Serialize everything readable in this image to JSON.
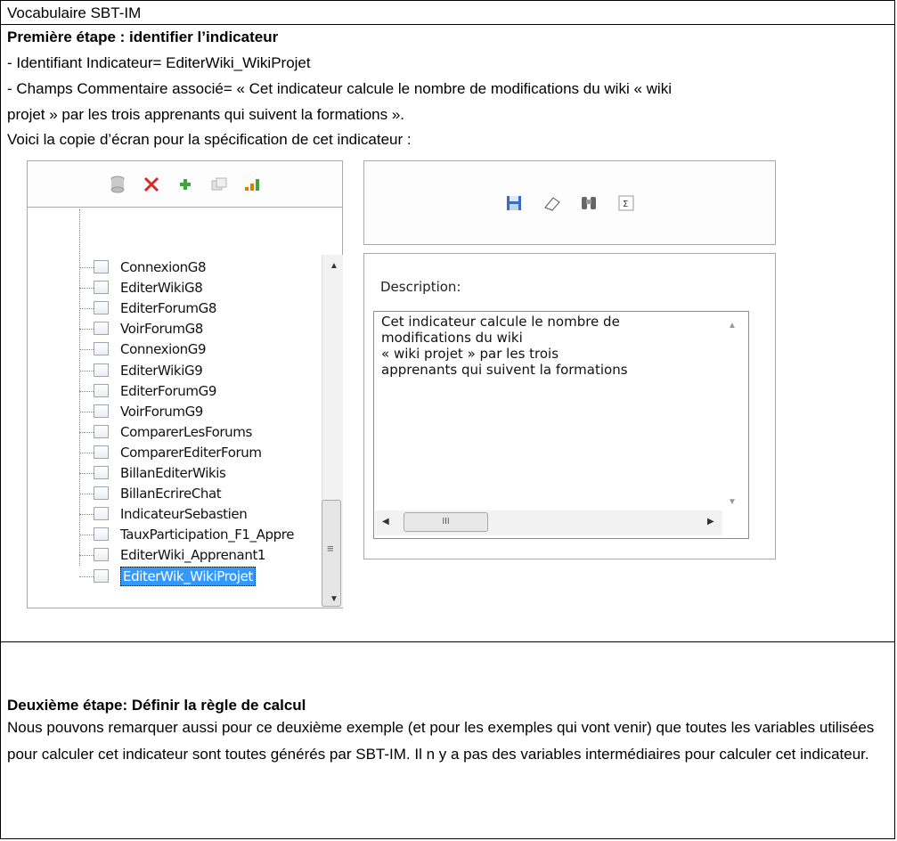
{
  "header": {
    "title": "Vocabulaire SBT-IM"
  },
  "step1": {
    "heading": "Première étape : identifier l’indicateur",
    "line1": "- Identifiant Indicateur= EditerWiki_WikiProjet",
    "line2": "- Champs Commentaire associé= « Cet indicateur calcule le nombre de modifications du wiki « wiki",
    "line3": "projet » par les trois apprenants qui suivent la formations ».",
    "line4": "Voici la copie d’écran pour la spécification de cet indicateur :"
  },
  "screenshot": {
    "left_toolbar_icons": [
      "database-icon",
      "delete-icon",
      "add-icon",
      "copy-icon",
      "chart-icon"
    ],
    "right_toolbar_icons": [
      "save-icon",
      "eraser-icon",
      "binoculars-icon",
      "formula-icon"
    ],
    "tree_items": [
      "ConnexionG8",
      "EditerWikiG8",
      "EditerForumG8",
      "VoirForumG8",
      "ConnexionG9",
      "EditerWikiG9",
      "EditerForumG9",
      "VoirForumG9",
      "ComparerLesForums",
      "ComparerEditerForum",
      "BillanEditerWikis",
      "BillanEcrireChat",
      "IndicateurSebastien",
      "TauxParticipation_F1_Appre",
      "EditerWiki_Apprenant1",
      "EditerWik_WikiProjet"
    ],
    "selected_item": "EditerWik_WikiProjet",
    "description_label": "Description:",
    "description_text": "Cet indicateur calcule le nombre de\nmodifications du wiki\n« wiki projet » par les trois\napprenants qui suivent la formations",
    "hscroll_grip": "III",
    "vscroll_grip": "≡"
  },
  "step2": {
    "heading": "Deuxième étape: Définir la règle de calcul",
    "body": "Nous pouvons remarquer aussi pour ce deuxième exemple (et pour les exemples qui vont venir) que toutes les variables utilisées pour calculer cet indicateur sont toutes générés par SBT-IM. Il n y a pas des variables intermédiaires pour calculer cet indicateur."
  }
}
